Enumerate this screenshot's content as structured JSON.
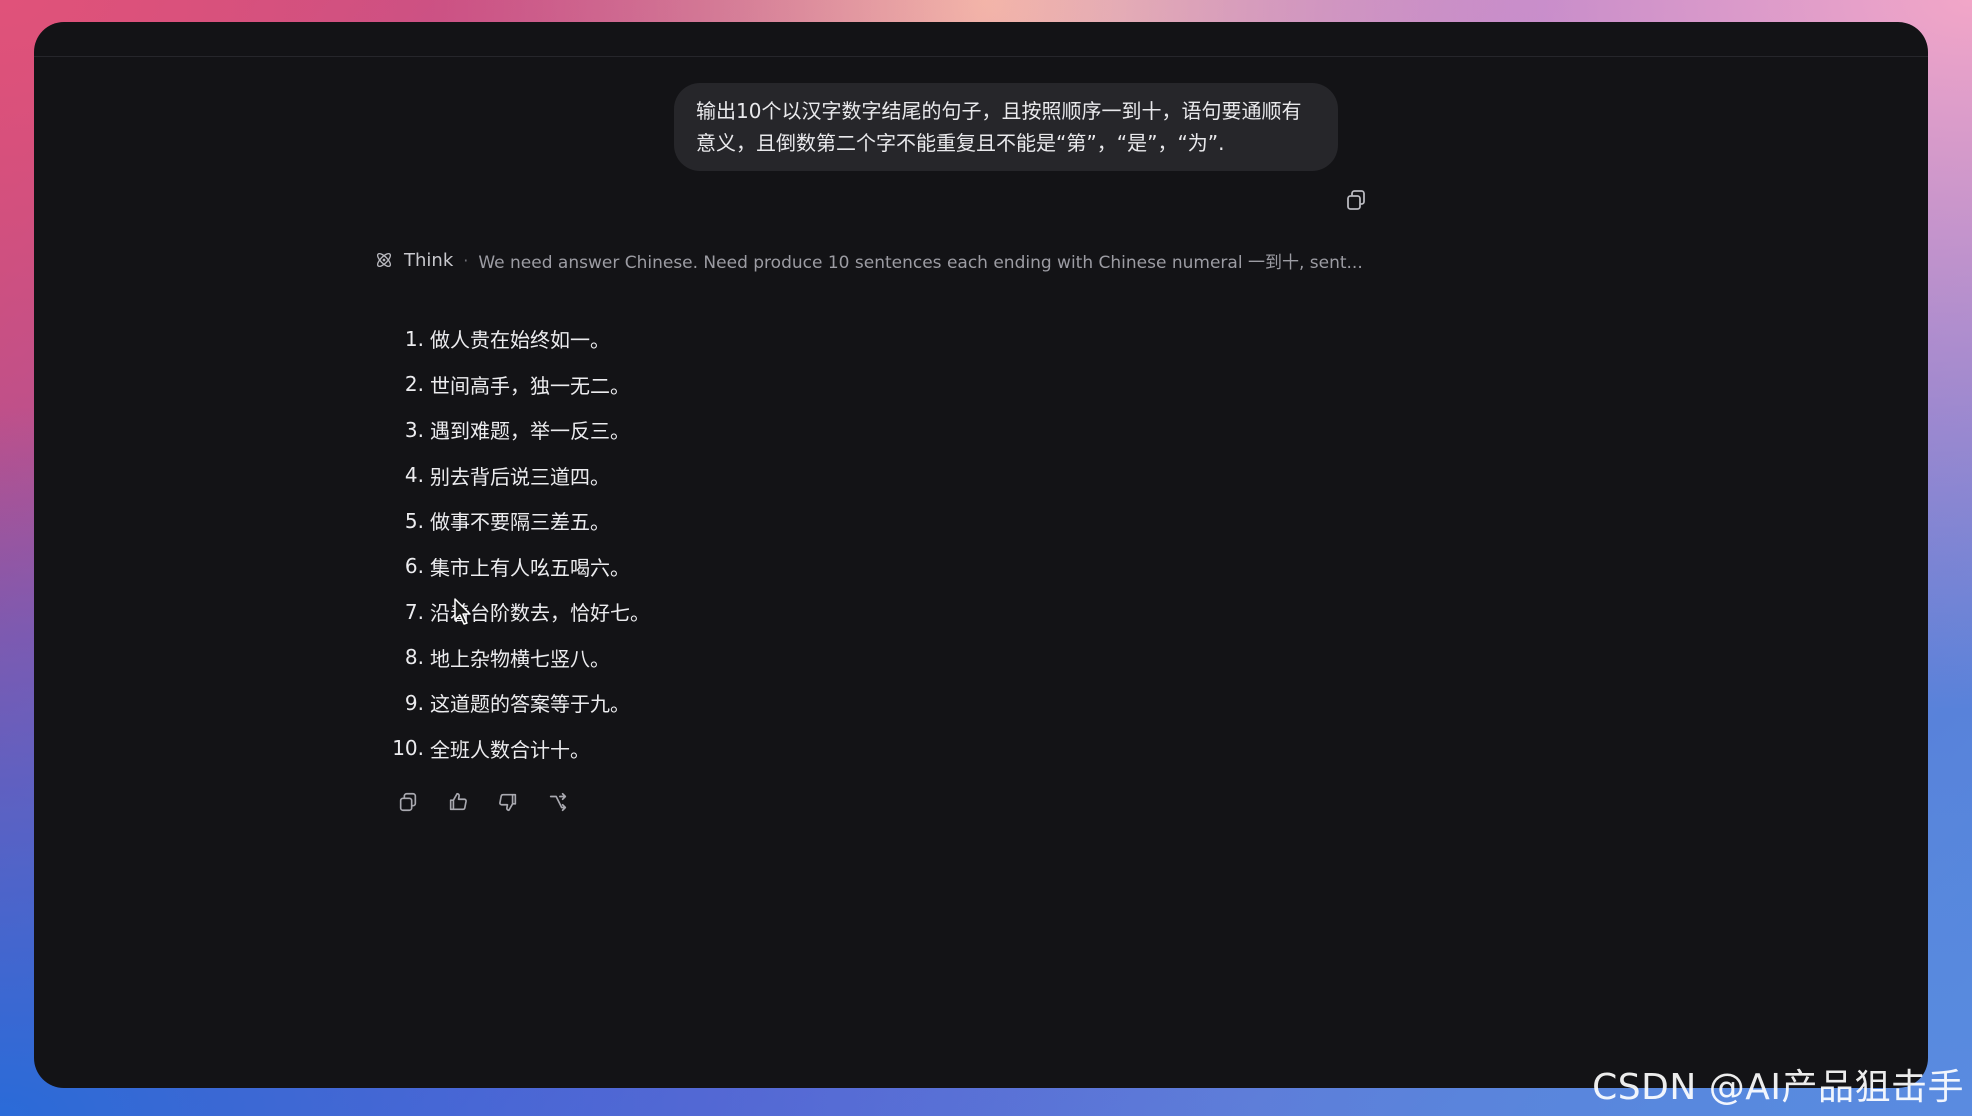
{
  "user_message": {
    "text": "输出10个以汉字数字结尾的句子，且按照顺序一到十，语句要通顺有意义，且倒数第二个字不能重复且不能是“第”，“是”，“为”."
  },
  "think": {
    "label": "Think",
    "separator": "·",
    "summary": "We need answer Chinese. Need produce 10 sentences each ending with Chinese numeral 一到十, sent..."
  },
  "answer": {
    "items": [
      {
        "num": "1.",
        "text": "做人贵在始终如一。"
      },
      {
        "num": "2.",
        "text": "世间高手，独一无二。"
      },
      {
        "num": "3.",
        "text": "遇到难题，举一反三。"
      },
      {
        "num": "4.",
        "text": "别去背后说三道四。"
      },
      {
        "num": "5.",
        "text": "做事不要隔三差五。"
      },
      {
        "num": "6.",
        "text": "集市上有人吆五喝六。"
      },
      {
        "num": "7.",
        "text": "沿着台阶数去，恰好七。"
      },
      {
        "num": "8.",
        "text": "地上杂物横七竖八。"
      },
      {
        "num": "9.",
        "text": "这道题的答案等于九。"
      },
      {
        "num": "10.",
        "text": "全班人数合计十。"
      }
    ]
  },
  "actions": [
    "copy-icon",
    "thumbs-up-icon",
    "thumbs-down-icon",
    "branch-icon"
  ],
  "watermark": "CSDN @AI产品狙击手",
  "colors": {
    "window_bg": "#131316",
    "bubble_bg": "#26262a",
    "text": "#ececef",
    "muted": "#9c9ca3"
  }
}
